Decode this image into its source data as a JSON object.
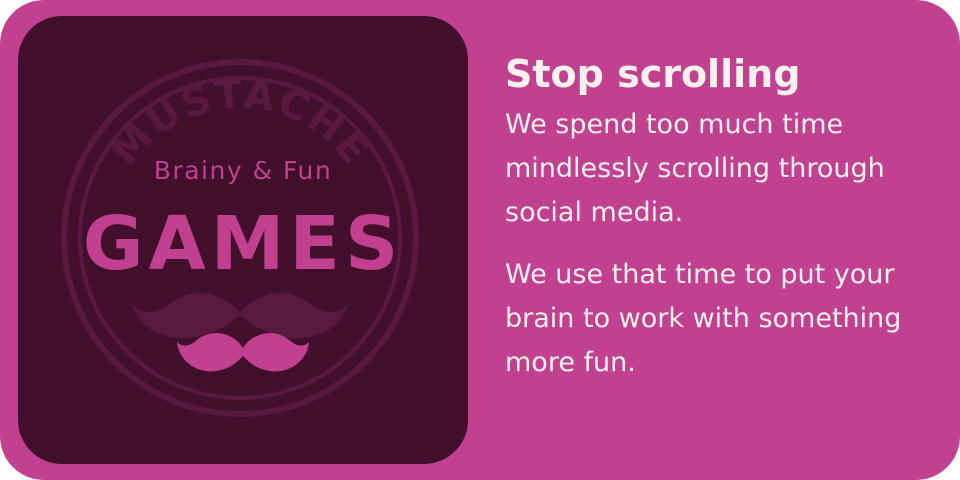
{
  "tile": {
    "subtitle": "Brainy & Fun",
    "title": "GAMES",
    "watermark_text": "MUSTACHE",
    "watermark_icon": "mustache-icon",
    "icon": "mustache-icon"
  },
  "content": {
    "heading": "Stop scrolling",
    "paragraphs": [
      "We spend too much time mindlessly scrolling through social media.",
      "We use that time to put your brain to work with something more fun."
    ]
  },
  "colors": {
    "card_background": "#c1408f",
    "tile_background": "#420f2d",
    "accent": "#c1408f",
    "text": "#fdf1ee"
  }
}
